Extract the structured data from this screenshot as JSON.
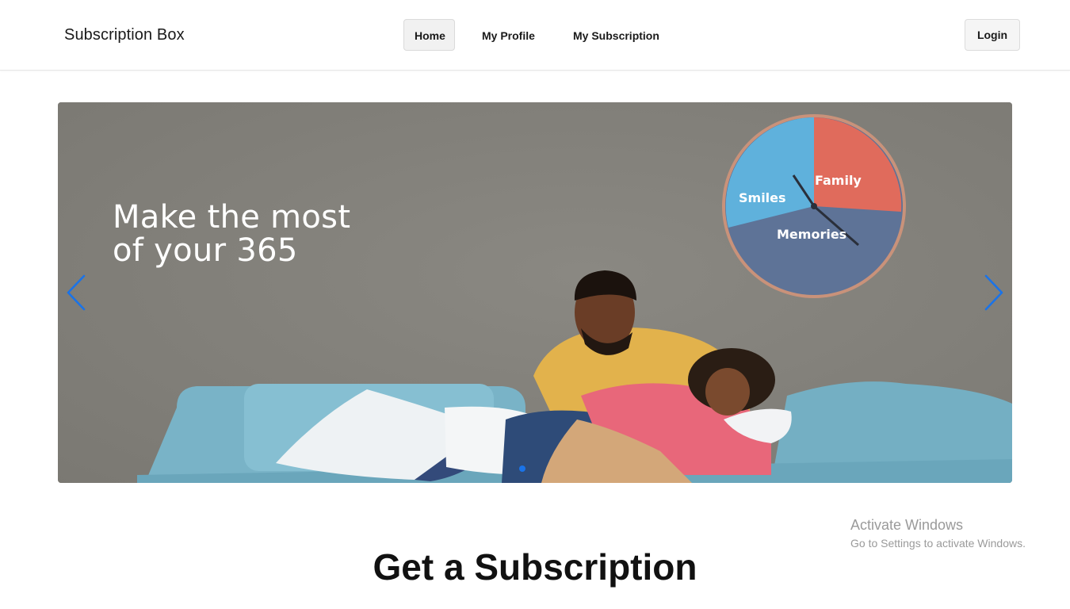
{
  "navbar": {
    "brand": "Subscription Box",
    "links": [
      {
        "label": "Home",
        "active": true
      },
      {
        "label": "My Profile",
        "active": false
      },
      {
        "label": "My Subscription",
        "active": false
      }
    ],
    "login_label": "Login"
  },
  "carousel": {
    "slide": {
      "headline_line1": "Make the most",
      "headline_line2": "of your 365",
      "clock_segments": [
        "Family",
        "Smiles",
        "Memories"
      ]
    },
    "prev_icon": "chevron-left-icon",
    "next_icon": "chevron-right-icon",
    "slide_count": 1,
    "active_index": 0,
    "accent_color": "#1a73e8"
  },
  "main": {
    "section_title": "Get a Subscription"
  },
  "watermark": {
    "title": "Activate Windows",
    "subtitle": "Go to Settings to activate Windows."
  }
}
